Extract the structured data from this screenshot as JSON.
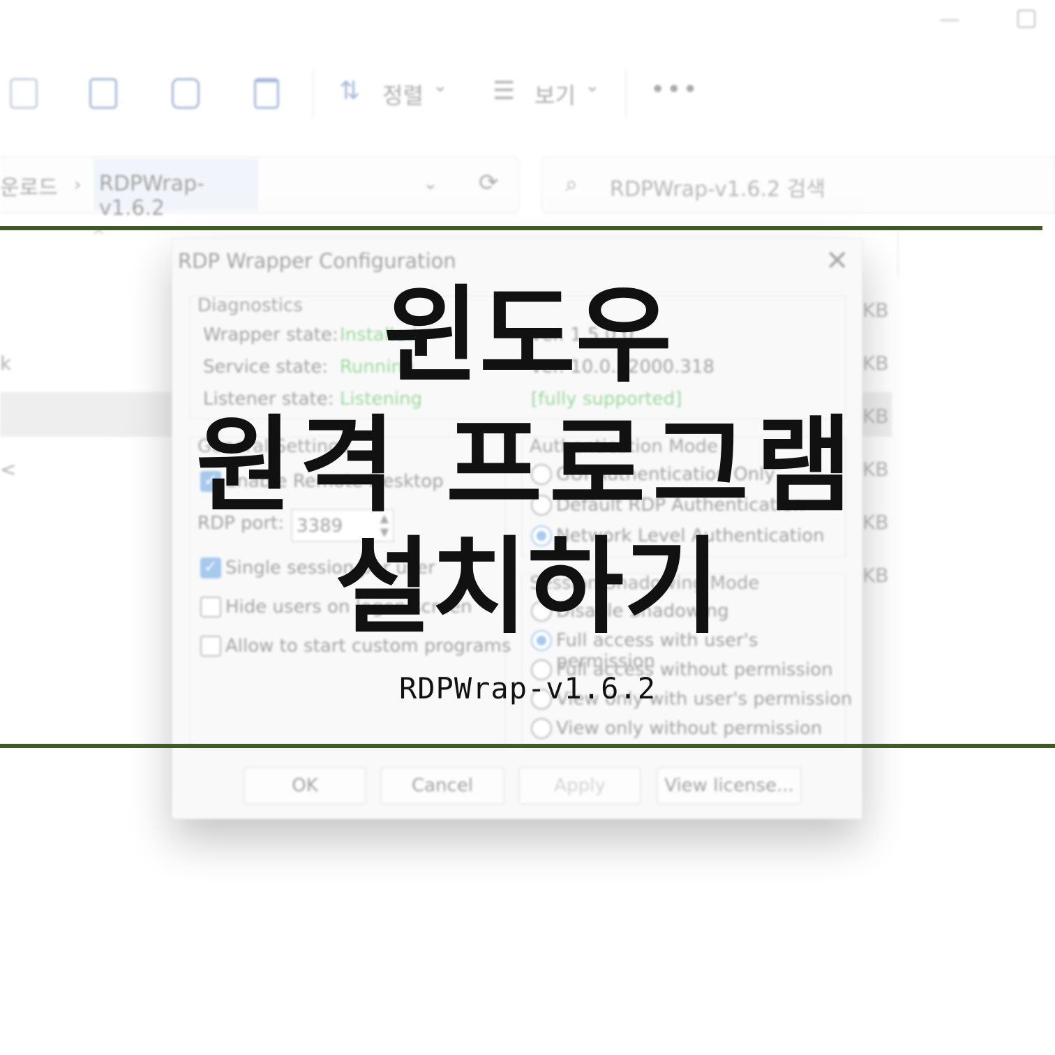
{
  "window": {
    "minimize_icon": "minimize-icon",
    "maximize_icon": "maximize-icon"
  },
  "toolbar": {
    "sort_label": "정렬",
    "view_label": "보기",
    "dropdown_glyph": "⌄",
    "more_glyph": "•••",
    "sort_glyph": "⇅",
    "view_glyph": "☰"
  },
  "address": {
    "previous_crumb": "운로드",
    "separator": "›",
    "current_folder": "RDPWrap-v1.6.2",
    "search_placeholder": "RDPWrap-v1.6.2 검색"
  },
  "file_list": {
    "size_units": [
      "KB",
      "KB",
      "KB",
      "KB",
      "KB",
      "KB"
    ],
    "sidebar_fragments": [
      "k",
      "<"
    ]
  },
  "dialog": {
    "title": "RDP Wrapper Configuration",
    "close_glyph": "✕",
    "diagnostics": {
      "title": "Diagnostics",
      "wrapper_state_label": "Wrapper state:",
      "wrapper_state_value": "Installed",
      "service_state_label": "Service state:",
      "service_state_value": "Running",
      "listener_state_label": "Listener state:",
      "listener_state_value": "Listening",
      "version_line": "ver. 1.5.0.0",
      "termsrv_line": "ver. 10.0.22000.318",
      "support_status": "[fully supported]"
    },
    "general": {
      "title": "General Settings",
      "enable_remote_desktop": "Enable Remote Desktop",
      "rdp_port_label": "RDP port:",
      "rdp_port_value": "3389",
      "single_session": "Single session per user",
      "hide_users": "Hide users on logon screen",
      "allow_custom_programs": "Allow to start custom programs"
    },
    "auth": {
      "title": "Authentication Mode",
      "options": [
        "GUI Authentication Only",
        "Default RDP Authentication",
        "Network Level Authentication"
      ],
      "selected": "Network Level Authentication"
    },
    "shadow": {
      "title": "Session Shadowing Mode",
      "options": [
        "Disable Shadowing",
        "Full access with user's permission",
        "Full access without permission",
        "View only with user's permission",
        "View only without permission"
      ],
      "selected": "Full access with user's permission"
    },
    "buttons": {
      "ok": "OK",
      "cancel": "Cancel",
      "apply": "Apply",
      "view_license": "View license..."
    }
  },
  "overlay": {
    "title_line1": "윈도우",
    "title_line2": "원격 프로그램",
    "title_line3": "설치하기",
    "subtitle": "RDPWrap-v1.6.2",
    "line_color": "#3f5a24"
  }
}
